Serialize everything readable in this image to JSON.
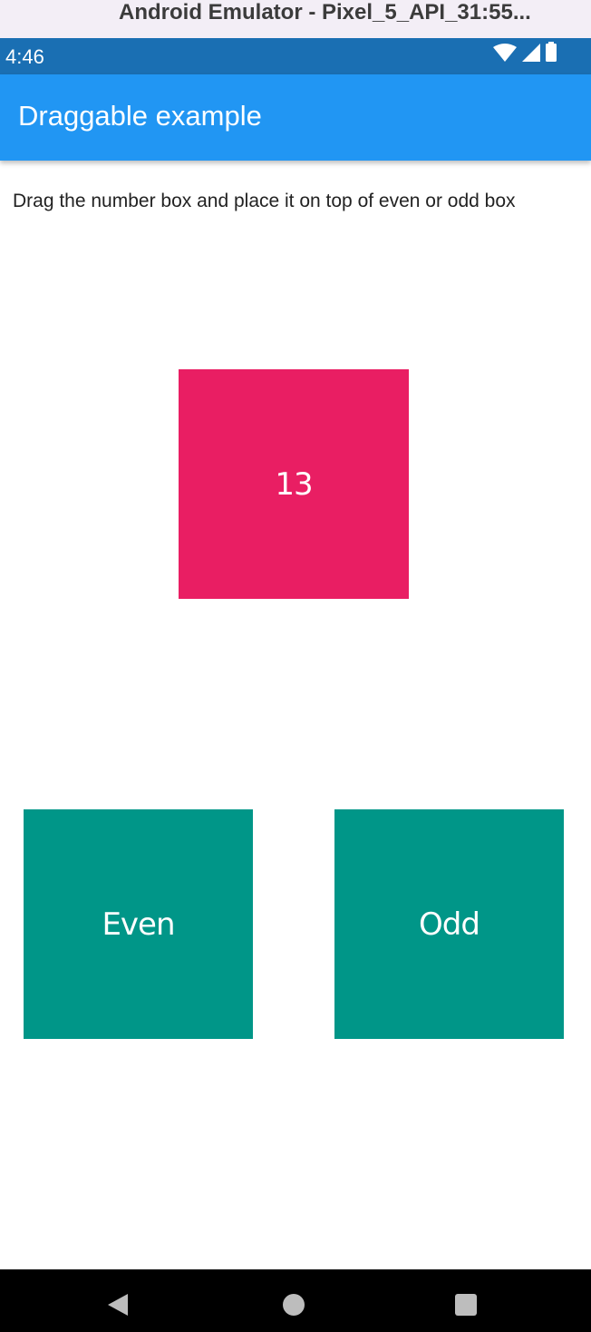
{
  "window": {
    "title": "Android Emulator - Pixel_5_API_31:55..."
  },
  "status_bar": {
    "time": "4:46",
    "icons": [
      "wifi-icon",
      "signal-icon",
      "battery-icon"
    ]
  },
  "app_bar": {
    "title": "Draggable example",
    "color": "#2196f3"
  },
  "body": {
    "instruction": "Drag the number box and place it on top of even or odd box",
    "draggable": {
      "label": "13",
      "color": "#e91e63"
    },
    "targets": [
      {
        "label": "Even",
        "color": "#009688"
      },
      {
        "label": "Odd",
        "color": "#009688"
      }
    ]
  },
  "nav_bar": {
    "icons": [
      "back-icon",
      "home-icon",
      "recents-icon"
    ]
  }
}
